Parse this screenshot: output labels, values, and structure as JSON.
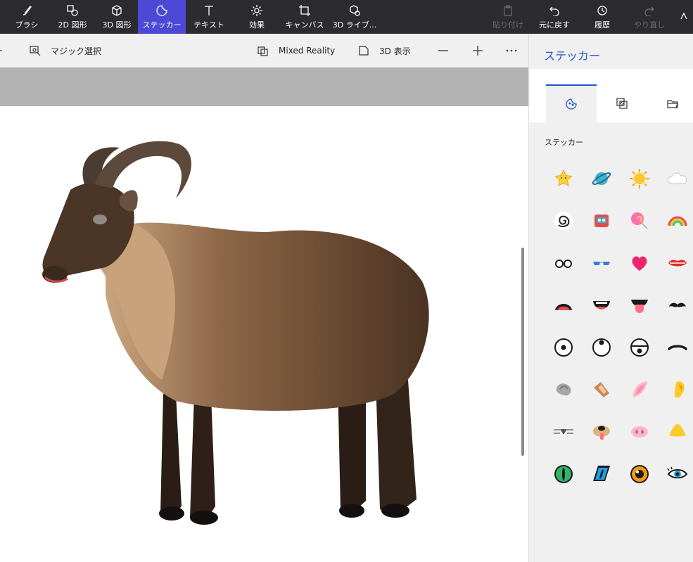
{
  "toolbar": {
    "tools": [
      {
        "label": "ブラシ",
        "icon": "brush-icon"
      },
      {
        "label": "2D 図形",
        "icon": "2d-shapes-icon"
      },
      {
        "label": "3D 図形",
        "icon": "3d-shapes-icon"
      },
      {
        "label": "ステッカー",
        "icon": "sticker-icon"
      },
      {
        "label": "テキスト",
        "icon": "text-icon"
      },
      {
        "label": "効果",
        "icon": "effects-icon"
      },
      {
        "label": "キャンバス",
        "icon": "canvas-icon"
      },
      {
        "label": "3D ライブ...",
        "icon": "3d-library-icon"
      }
    ],
    "actions": [
      {
        "label": "貼り付け",
        "icon": "paste-icon"
      },
      {
        "label": "元に戻す",
        "icon": "undo-icon"
      },
      {
        "label": "履歴",
        "icon": "history-icon"
      },
      {
        "label": "やり直し",
        "icon": "redo-icon"
      }
    ],
    "active_tool": "ステッカー"
  },
  "subbar": {
    "magic_select": "マジック選択",
    "mixed_reality": "Mixed Reality",
    "view_3d": "3D 表示"
  },
  "panel": {
    "title": "ステッカー",
    "section_label": "ステッカー",
    "tabs": [
      "sticker-tab-icon",
      "texture-tab-icon",
      "folder-tab-icon"
    ]
  },
  "stickers": [
    "star",
    "planet",
    "sun",
    "cloud",
    "spiral",
    "robot",
    "lollipop",
    "rainbow",
    "glasses",
    "sunglasses",
    "heart",
    "lips",
    "mouth-frown",
    "mouth-smile",
    "tongue",
    "mustache",
    "eye-center",
    "eye-up",
    "eye-down",
    "eyebrow",
    "ear-gray",
    "ear-dog",
    "ear-pink",
    "ear-yellow",
    "nose-whiskers",
    "nose-dog",
    "nose-pig",
    "nose-beak",
    "eye-green",
    "eye-blue",
    "eye-orange",
    "eye-lash"
  ],
  "colors": {
    "accent": "#4c49d6",
    "link": "#1a57c8",
    "toolbar_bg": "#2b2b30"
  }
}
